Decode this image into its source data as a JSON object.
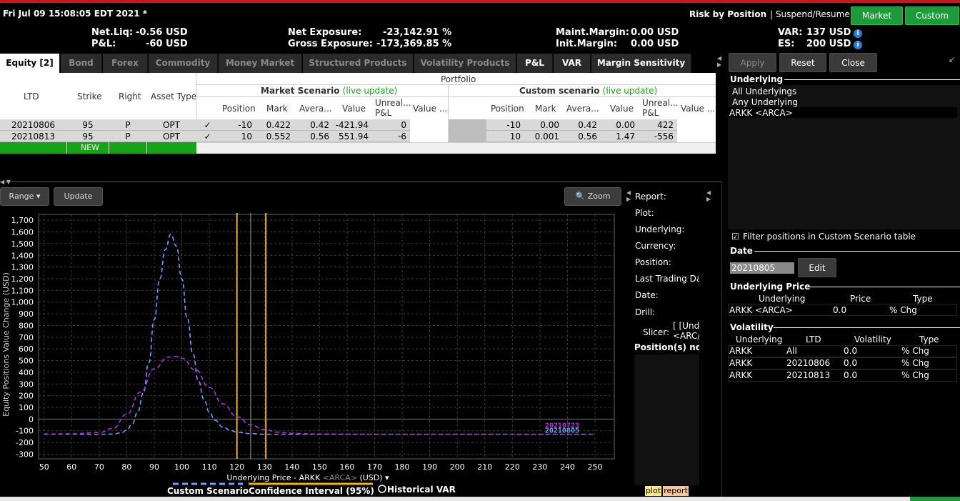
{
  "titlebar": {
    "datetime": "Fri Jul 09 15:08:05 EDT 2021 *",
    "mode": "Risk by Position",
    "suspend_label": "| Suspend/Resume:",
    "market_btn": "Market",
    "custom_btn": "Custom"
  },
  "summary": {
    "netliq_label": "Net.Liq:",
    "netliq_value": "-0.56 USD",
    "pnl_label": "P&L:",
    "pnl_value": "-60 USD",
    "net_exposure_label": "Net Exposure:",
    "net_exposure_value": "-23,142.91 %",
    "gross_exposure_label": "Gross Exposure:",
    "gross_exposure_value": "-173,369.85 %",
    "maint_margin_label": "Maint.Margin:",
    "maint_margin_value": "0.00 USD",
    "init_margin_label": "Init.Margin:",
    "init_margin_value": "0.00 USD",
    "var_label": "VAR:",
    "var_value": "137 USD",
    "es_label": "ES:",
    "es_value": "200 USD",
    "info_glyph": "i"
  },
  "tabs": [
    "Equity [2]",
    "Bond",
    "Forex",
    "Commodity",
    "Money Market",
    "Structured Products",
    "Volatility Products",
    "P&L",
    "VAR",
    "Margin Sensitivity"
  ],
  "grid": {
    "portfolio_label": "Portfolio",
    "market_scenario_label": "Market Scenario",
    "custom_scenario_label": "Custom scenario",
    "live_update": "(live update)",
    "cols_left": [
      "LTD",
      "Strike",
      "Right",
      "Asset Type"
    ],
    "cols_market": [
      "Position",
      "Mark",
      "Avera...",
      "Value",
      "Unreal... P&L",
      "Value ..."
    ],
    "cols_custom": [
      "Position",
      "Mark",
      "Avera...",
      "Value",
      "Unreal... P&L",
      "Value ..."
    ],
    "rows": [
      {
        "ltd": "20210806",
        "strike": "95",
        "right": "P",
        "type": "OPT",
        "check": "✓",
        "m_pos": "-10",
        "m_mark": "0.422",
        "m_avg": "0.42",
        "m_val": "-421.94",
        "m_pnl": "0",
        "c_pos": "-10",
        "c_mark": "0.00",
        "c_avg": "0.42",
        "c_val": "0.00",
        "c_pnl": "422"
      },
      {
        "ltd": "20210813",
        "strike": "95",
        "right": "P",
        "type": "OPT",
        "check": "✓",
        "m_pos": "10",
        "m_mark": "0.552",
        "m_avg": "0.56",
        "m_val": "551.94",
        "m_pnl": "-6",
        "c_pos": "10",
        "c_mark": "0.001",
        "c_avg": "0.56",
        "c_val": "1.47",
        "c_pnl": "-556"
      }
    ],
    "new_label": "NEW"
  },
  "side": {
    "apply": "Apply",
    "reset": "Reset",
    "close": "Close",
    "underlying_title": "Underlying",
    "underlying_items": [
      "All Underlyings",
      "Any Underlying",
      "ARKK <ARCA>"
    ],
    "filter_label": "Filter positions in Custom Scenario table",
    "date_title": "Date",
    "date_value": "20210805",
    "edit": "Edit",
    "uprice_title": "Underlying Price",
    "uprice_cols": [
      "Underlying",
      "Price",
      "Type"
    ],
    "uprice_row": [
      "ARKK <ARCA>",
      "0.0",
      "% Chg"
    ],
    "vol_title": "Volatility",
    "vol_cols": [
      "Underlying",
      "LTD",
      "Volatility",
      "Type"
    ],
    "vol_rows": [
      [
        "ARKK",
        "All",
        "0.0",
        "% Chg"
      ],
      [
        "ARKK",
        "20210806",
        "0.0",
        "% Chg"
      ],
      [
        "ARKK",
        "20210813",
        "0.0",
        "% Chg"
      ]
    ]
  },
  "chart_toolbar": {
    "range": "Range ▾",
    "update": "Update",
    "zoom": "Zoom"
  },
  "report_panel": {
    "report": "Report:",
    "plot": "Plot:",
    "underlying": "Underlying:",
    "currency": "Currency:",
    "position": "Position:",
    "last_trading": "Last Trading Da",
    "date": "Date:",
    "drill": "Drill:",
    "slicer": "Slicer:",
    "slicer_val1": "[ [Und",
    "slicer_val2": "<ARC/",
    "positions_no": "Position(s) no",
    "plot_tab": "plot",
    "report_tab": "report"
  },
  "chart_data": {
    "type": "line",
    "xlabel": "Underlying Price - ARKK <ARCA> (USD) ▾",
    "xlabel_main": "Underlying Price - ARKK ",
    "xlabel_exch": "<ARCA>",
    "xlabel_tail": " (USD) ▾",
    "ylabel": "Equity Positions Value Change (USD)",
    "xlim": [
      48,
      257
    ],
    "ylim": [
      -340,
      1750
    ],
    "x_ticks": [
      50,
      60,
      70,
      80,
      90,
      100,
      110,
      120,
      130,
      140,
      150,
      160,
      170,
      180,
      190,
      200,
      210,
      220,
      230,
      240,
      250
    ],
    "y_ticks": [
      -300,
      -200,
      -100,
      0,
      100,
      200,
      300,
      400,
      500,
      600,
      700,
      800,
      900,
      1000,
      1100,
      1200,
      1300,
      1400,
      1500,
      1600,
      1700
    ],
    "y_tick_labels": [
      "-300",
      "-200",
      "-100",
      "0",
      "100",
      "200",
      "300",
      "400",
      "500",
      "600",
      "700",
      "800",
      "900",
      "1,000",
      "1,100",
      "1,200",
      "1,300",
      "1,400",
      "1,500",
      "1,600",
      "1,700"
    ],
    "grid": true,
    "vertical_lines": [
      {
        "x": 120,
        "color": "#e8b21a"
      },
      {
        "x": 125,
        "color": "#888888"
      },
      {
        "x": 130.5,
        "color": "#e8b21a"
      }
    ],
    "series": [
      {
        "name": "20210805",
        "color": "#6aa0ff",
        "x": [
          50,
          60,
          70,
          75,
          78,
          80,
          82,
          84,
          86,
          88,
          90,
          92,
          94,
          96,
          98,
          100,
          102,
          104,
          106,
          108,
          110,
          112,
          115,
          118,
          120,
          125,
          130,
          140,
          150,
          170,
          200,
          250
        ],
        "y": [
          -130,
          -130,
          -130,
          -128,
          -118,
          -95,
          -40,
          60,
          220,
          480,
          850,
          1200,
          1450,
          1580,
          1480,
          1200,
          860,
          560,
          330,
          170,
          60,
          -10,
          -70,
          -100,
          -112,
          -125,
          -130,
          -130,
          -130,
          -130,
          -130,
          -130
        ]
      },
      {
        "name": "20210723",
        "color": "#b030e0",
        "x": [
          50,
          60,
          70,
          75,
          80,
          85,
          90,
          95,
          98,
          100,
          105,
          110,
          115,
          120,
          125,
          130,
          135,
          140,
          150,
          170,
          200,
          250
        ],
        "y": [
          -128,
          -126,
          -115,
          -80,
          40,
          230,
          430,
          530,
          535,
          520,
          420,
          270,
          130,
          20,
          -50,
          -90,
          -112,
          -122,
          -128,
          -130,
          -130,
          -130
        ]
      }
    ],
    "legend": [
      "Custom Scenario",
      "Confidence Interval (95%)",
      "Historical VAR"
    ]
  }
}
